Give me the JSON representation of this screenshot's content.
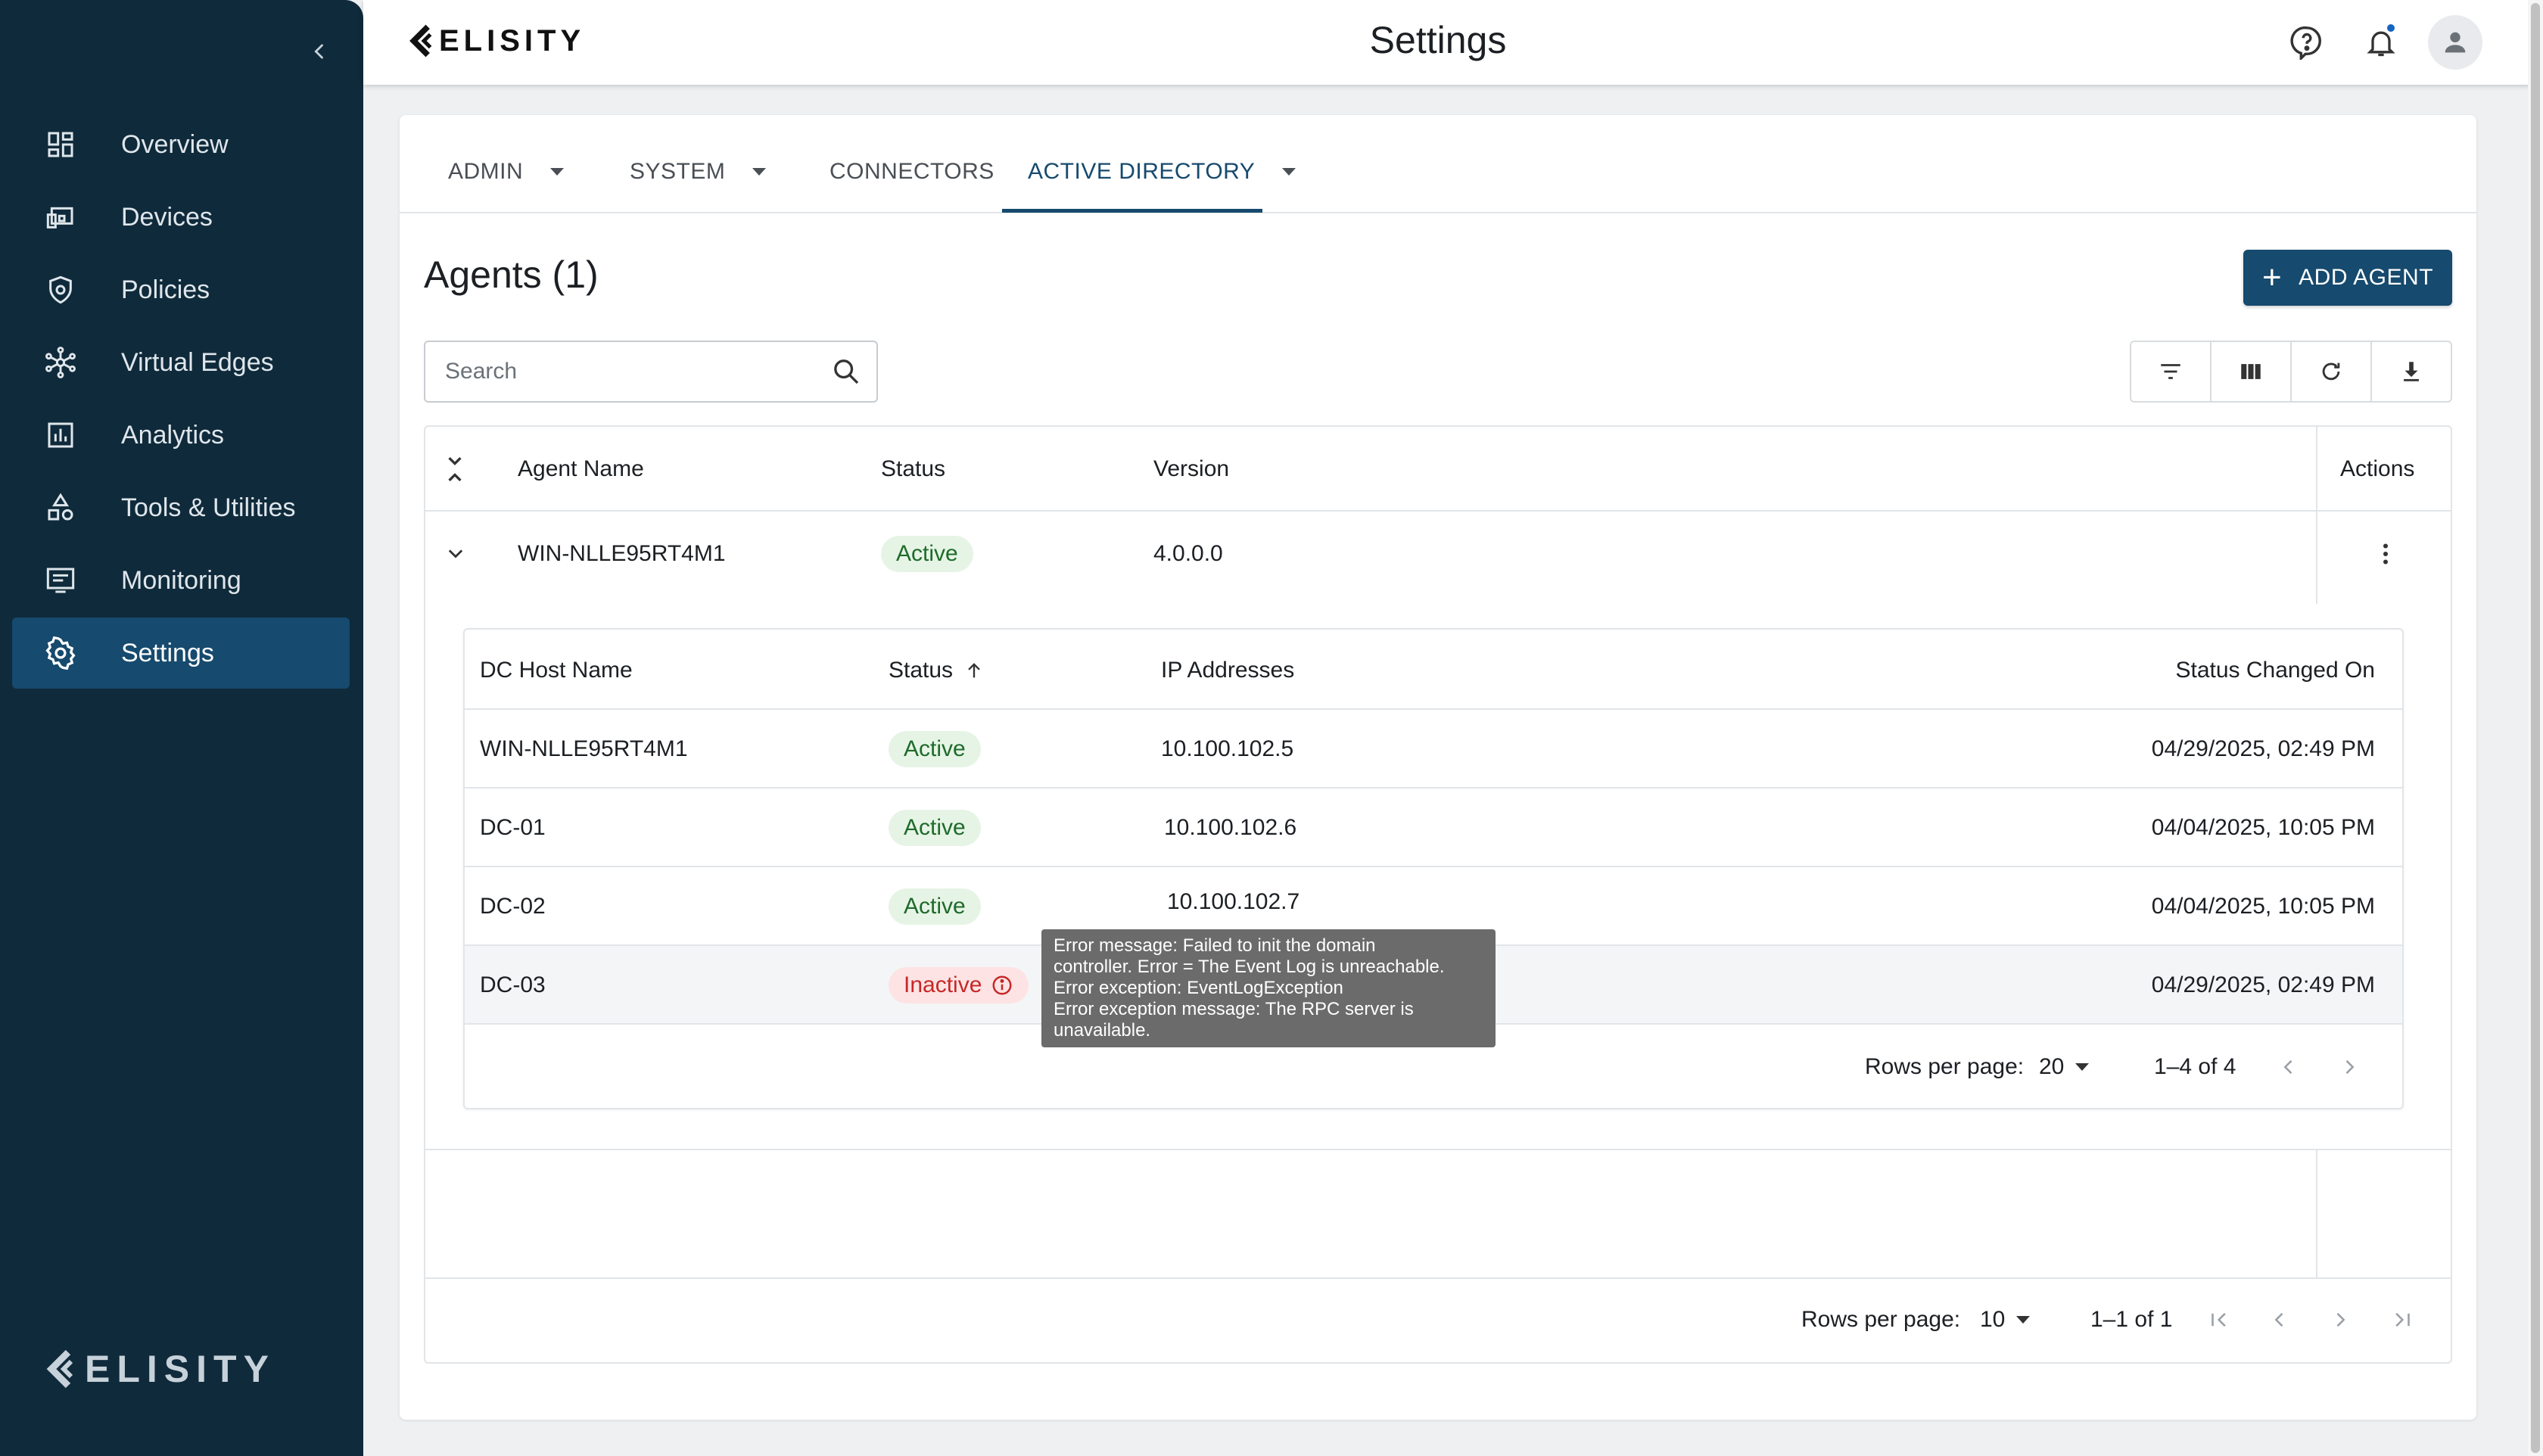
{
  "app": {
    "brand": "ELISITY",
    "page_title": "Settings"
  },
  "sidebar": {
    "items": [
      {
        "label": "Overview",
        "icon": "overview-icon"
      },
      {
        "label": "Devices",
        "icon": "devices-icon"
      },
      {
        "label": "Policies",
        "icon": "policies-icon"
      },
      {
        "label": "Virtual Edges",
        "icon": "virtual-edges-icon"
      },
      {
        "label": "Analytics",
        "icon": "analytics-icon"
      },
      {
        "label": "Tools & Utilities",
        "icon": "tools-icon"
      },
      {
        "label": "Monitoring",
        "icon": "monitoring-icon"
      },
      {
        "label": "Settings",
        "icon": "gear-icon",
        "active": true
      }
    ],
    "logo_text": "ELISITY"
  },
  "tabs": [
    {
      "label": "ADMIN"
    },
    {
      "label": "SYSTEM"
    },
    {
      "label": "CONNECTORS"
    },
    {
      "label": "ACTIVE DIRECTORY",
      "active": true
    }
  ],
  "agents": {
    "title": "Agents (1)",
    "add_label": "ADD AGENT",
    "search_placeholder": "Search",
    "columns": {
      "name": "Agent Name",
      "status": "Status",
      "version": "Version",
      "actions": "Actions"
    },
    "rows": [
      {
        "name": "WIN-NLLE95RT4M1",
        "status": "Active",
        "version": "4.0.0.0"
      }
    ],
    "footer": {
      "rows_per_page_label": "Rows per page:",
      "rows_per_page": "10",
      "range": "1–1 of 1"
    }
  },
  "dc_table": {
    "columns": {
      "host": "DC Host Name",
      "status": "Status",
      "ip": "IP Addresses",
      "changed": "Status Changed On"
    },
    "rows": [
      {
        "host": "WIN-NLLE95RT4M1",
        "status": "Active",
        "ip": "10.100.102.5",
        "changed": "04/29/2025, 02:49 PM"
      },
      {
        "host": "DC-01",
        "status": "Active",
        "ip": "10.100.102.6",
        "changed": "04/04/2025, 10:05 PM"
      },
      {
        "host": "DC-02",
        "status": "Active",
        "ip": "10.100.102.7",
        "changed": "04/04/2025, 10:05 PM"
      },
      {
        "host": "DC-03",
        "status": "Inactive",
        "ip": "",
        "changed": "04/29/2025, 02:49 PM"
      }
    ],
    "footer": {
      "rows_per_page_label": "Rows per page:",
      "rows_per_page": "20",
      "range": "1–4 of 4"
    }
  },
  "tooltip": {
    "lines": [
      "Error message: Failed to init the domain",
      "controller. Error = The Event Log is unreachable.",
      "Error exception: EventLogException",
      "Error exception message: The RPC server is",
      "unavailable."
    ]
  },
  "colors": {
    "sidebar_bg": "#0f2a3b",
    "accent": "#164a6e",
    "active_green": "#1e6b2a",
    "inactive_red": "#c62828"
  }
}
